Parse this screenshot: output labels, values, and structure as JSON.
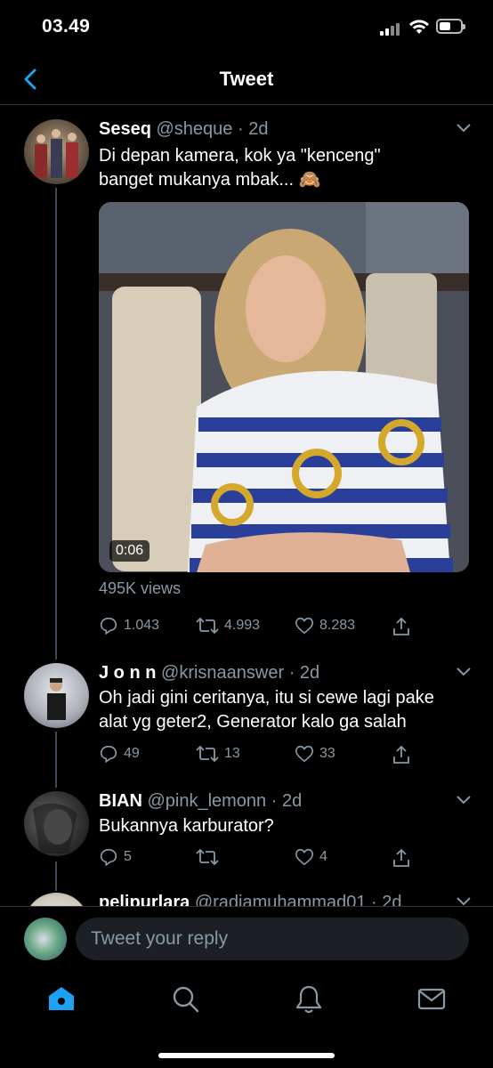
{
  "status_bar": {
    "time": "03.49"
  },
  "header": {
    "title": "Tweet",
    "back_icon": "chevron-left-icon"
  },
  "colors": {
    "accent": "#1da1f2",
    "muted": "#8899a6",
    "background": "#000000"
  },
  "main_tweet": {
    "name": "Seseq",
    "handle": "@sheque",
    "time": "2d",
    "text_line1": "Di depan kamera, kok ya \"kenceng\"",
    "text_line2": "banget mukanya mbak... 🙈",
    "video_duration": "0:06",
    "views": "495K views",
    "replies": "1.043",
    "retweets": "4.993",
    "likes": "8.283"
  },
  "replies": [
    {
      "name": "J o n n",
      "handle": "@krisnaanswer",
      "time": "2d",
      "text_line1": "Oh jadi gini ceritanya, itu si cewe lagi pake",
      "text_line2": "alat yg geter2, Generator kalo ga salah",
      "replies": "49",
      "retweets": "13",
      "likes": "33"
    },
    {
      "name": "BIAN",
      "handle": "@pink_lemonn",
      "time": "2d",
      "text_line1": "Bukannya karburator?",
      "replies": "5",
      "retweets": "",
      "likes": "4"
    },
    {
      "name": "pelipurlara",
      "handle": "@radiamuhammad01",
      "time": "2d"
    }
  ],
  "reply_bar": {
    "placeholder": "Tweet your reply"
  },
  "tab_bar": [
    "home-icon",
    "search-icon",
    "notifications-icon",
    "messages-icon"
  ]
}
